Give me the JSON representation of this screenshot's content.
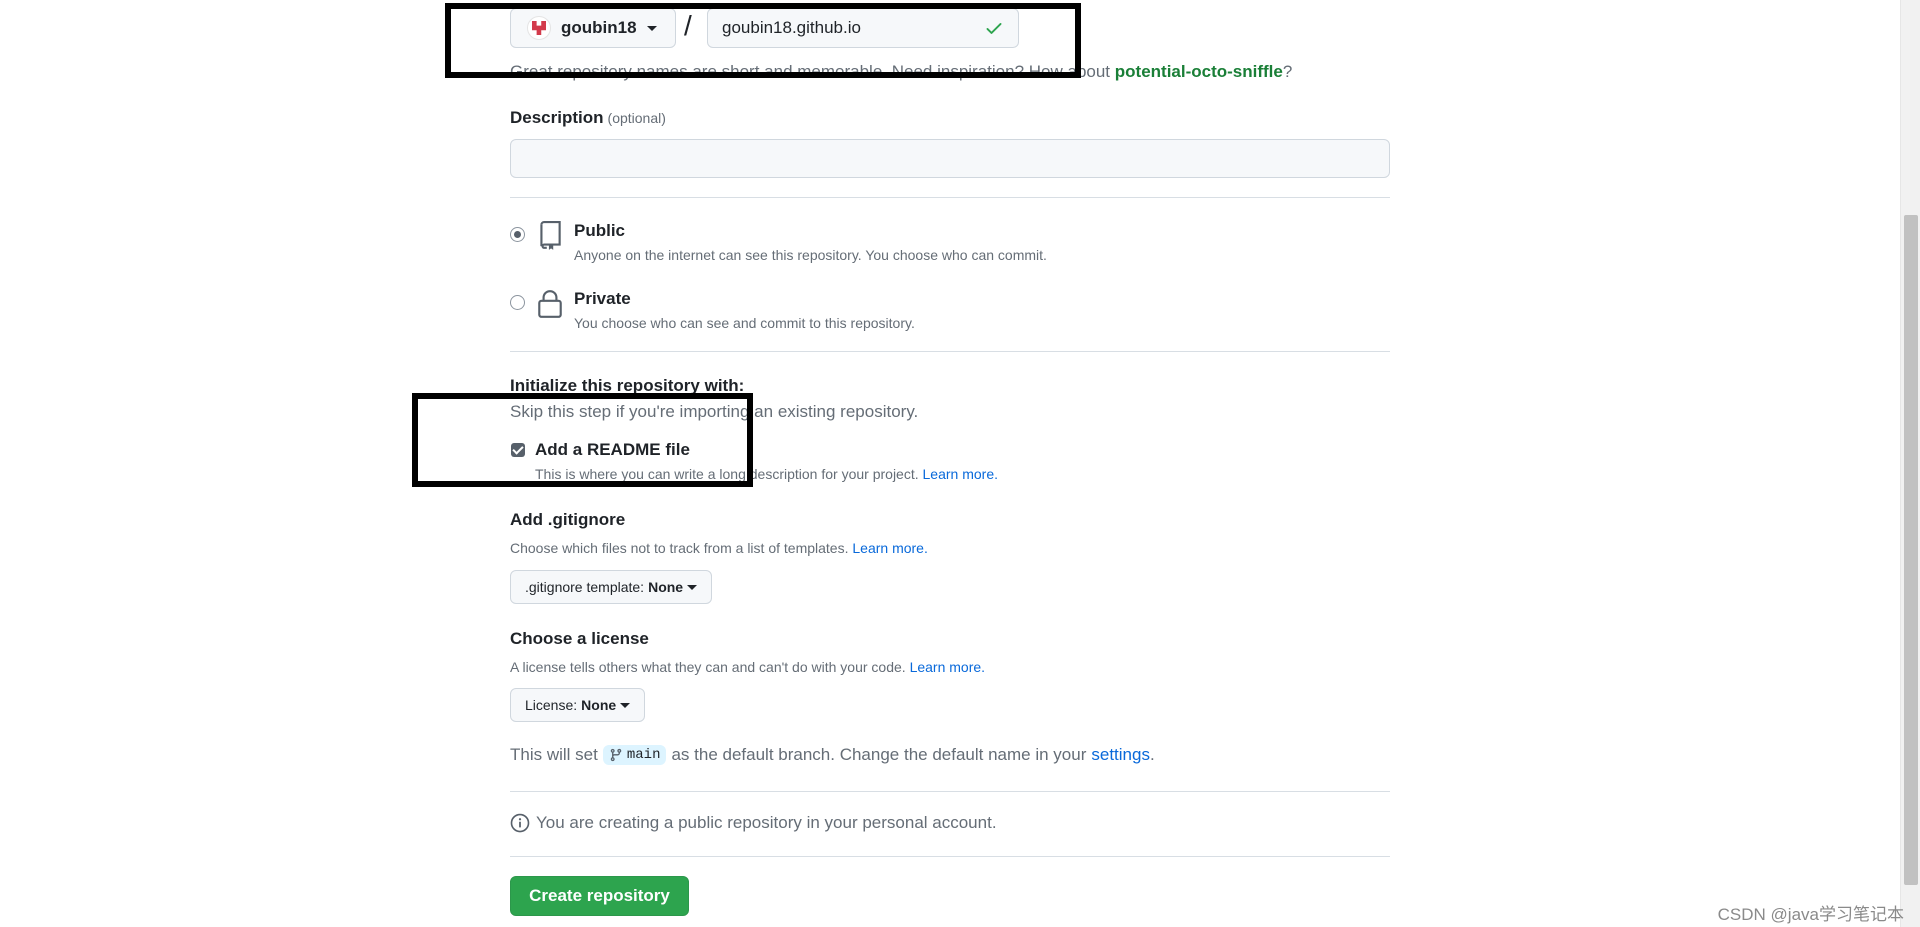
{
  "owner": {
    "name": "goubin18"
  },
  "repo": {
    "separator": "/",
    "name_value": "goubin18.github.io"
  },
  "hint": {
    "prefix": "Great repository names are short and memorable. Need inspiration? How about ",
    "suggestion": "potential-octo-sniffle",
    "suffix": "?"
  },
  "description": {
    "label": "Description",
    "optional": "(optional)",
    "value": ""
  },
  "visibility": {
    "public": {
      "label": "Public",
      "sub": "Anyone on the internet can see this repository. You choose who can commit.",
      "selected": true
    },
    "private": {
      "label": "Private",
      "sub": "You choose who can see and commit to this repository.",
      "selected": false
    }
  },
  "init": {
    "title": "Initialize this repository with:",
    "sub": "Skip this step if you're importing an existing repository.",
    "readme_label": "Add a README file",
    "readme_sub": "This is where you can write a long description for your project. ",
    "readme_link": "Learn more.",
    "readme_checked": true
  },
  "gitignore": {
    "title": "Add .gitignore",
    "sub": "Choose which files not to track from a list of templates. ",
    "link": "Learn more.",
    "select_prefix": ".gitignore template: ",
    "select_value": "None"
  },
  "license": {
    "title": "Choose a license",
    "sub": "A license tells others what they can and can't do with your code. ",
    "link": "Learn more.",
    "select_prefix": "License: ",
    "select_value": "None"
  },
  "branch": {
    "prefix": "This will set",
    "name": "main",
    "middle": "as the default branch. Change the default name in your",
    "link": "settings",
    "suffix": "."
  },
  "info": {
    "text": "You are creating a public repository in your personal account."
  },
  "create_button": {
    "label": "Create repository"
  },
  "watermark": {
    "text": "CSDN @java学习笔记本"
  },
  "colors": {
    "accent_green": "#2da44e",
    "link_blue": "#0969da",
    "suggestion_green": "#1a7f37",
    "annotation_black": "#000000"
  }
}
